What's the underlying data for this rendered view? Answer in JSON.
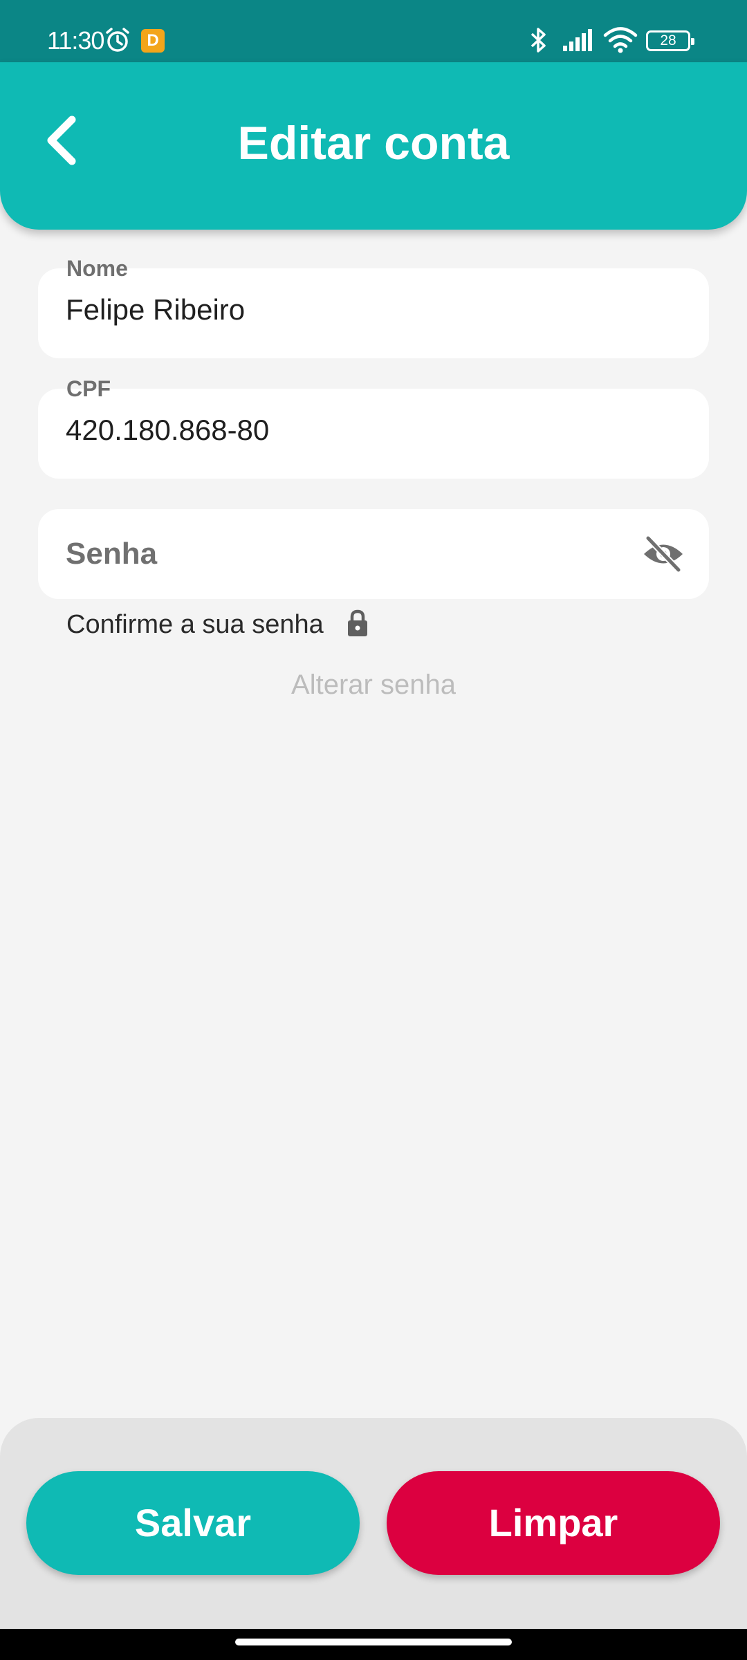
{
  "status_bar": {
    "time": "11:30",
    "notification_app_letter": "D",
    "battery_level": "28"
  },
  "header": {
    "title": "Editar conta",
    "back_icon": "chevron-left-icon"
  },
  "form": {
    "name": {
      "label": "Nome",
      "value": "Felipe Ribeiro"
    },
    "cpf": {
      "label": "CPF",
      "value": "420.180.868-80"
    },
    "password": {
      "placeholder": "Senha",
      "toggle_icon": "eye-off-icon"
    },
    "confirm_hint": "Confirme a sua senha",
    "change_password_link": "Alterar senha"
  },
  "actions": {
    "save_label": "Salvar",
    "clear_label": "Limpar"
  },
  "colors": {
    "status_bar": "#0b8686",
    "primary": "#0fbab4",
    "danger": "#dc0040",
    "background": "#f4f4f4"
  }
}
